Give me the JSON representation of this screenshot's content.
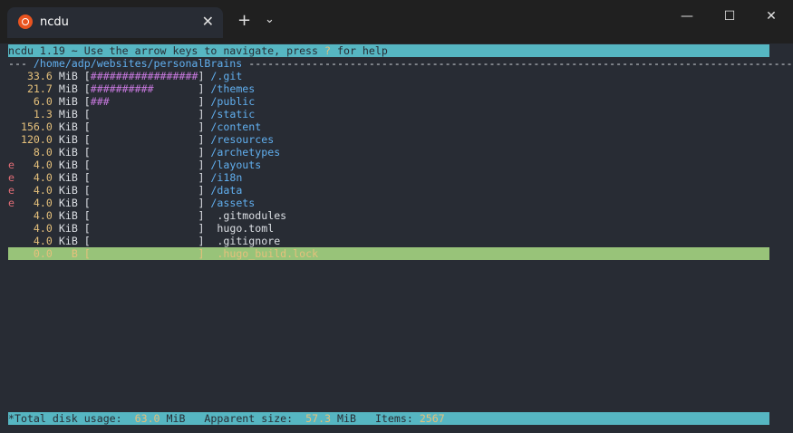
{
  "tab": {
    "title": "ncdu",
    "close": "✕"
  },
  "titlebar": {
    "newtab": "+",
    "dropdown": "⌄",
    "minimize": "—",
    "maximize": "☐",
    "close": "✕"
  },
  "header": {
    "prefix": "ncdu 1.19 ~ Use the arrow keys to navigate, press ",
    "key": "?",
    "suffix": " for help"
  },
  "pathline": {
    "lead": "--- ",
    "path": "/home/adp/websites/personalBrains",
    "trail": " ----------------------------------------------------------------------------------------"
  },
  "rows": [
    {
      "flag": " ",
      "size": "  33.6",
      "unit": "MiB",
      "bar": "#################",
      "name": "/.git",
      "isDir": true
    },
    {
      "flag": " ",
      "size": "  21.7",
      "unit": "MiB",
      "bar": "##########       ",
      "name": "/themes",
      "isDir": true
    },
    {
      "flag": " ",
      "size": "   6.0",
      "unit": "MiB",
      "bar": "###              ",
      "name": "/public",
      "isDir": true
    },
    {
      "flag": " ",
      "size": "   1.3",
      "unit": "MiB",
      "bar": "                 ",
      "name": "/static",
      "isDir": true
    },
    {
      "flag": " ",
      "size": " 156.0",
      "unit": "KiB",
      "bar": "                 ",
      "name": "/content",
      "isDir": true
    },
    {
      "flag": " ",
      "size": " 120.0",
      "unit": "KiB",
      "bar": "                 ",
      "name": "/resources",
      "isDir": true
    },
    {
      "flag": " ",
      "size": "   8.0",
      "unit": "KiB",
      "bar": "                 ",
      "name": "/archetypes",
      "isDir": true
    },
    {
      "flag": "e",
      "size": "   4.0",
      "unit": "KiB",
      "bar": "                 ",
      "name": "/layouts",
      "isDir": true
    },
    {
      "flag": "e",
      "size": "   4.0",
      "unit": "KiB",
      "bar": "                 ",
      "name": "/i18n",
      "isDir": true
    },
    {
      "flag": "e",
      "size": "   4.0",
      "unit": "KiB",
      "bar": "                 ",
      "name": "/data",
      "isDir": true
    },
    {
      "flag": "e",
      "size": "   4.0",
      "unit": "KiB",
      "bar": "                 ",
      "name": "/assets",
      "isDir": true
    },
    {
      "flag": " ",
      "size": "   4.0",
      "unit": "KiB",
      "bar": "                 ",
      "name": " .gitmodules",
      "isDir": false
    },
    {
      "flag": " ",
      "size": "   4.0",
      "unit": "KiB",
      "bar": "                 ",
      "name": " hugo.toml",
      "isDir": false
    },
    {
      "flag": " ",
      "size": "   4.0",
      "unit": "KiB",
      "bar": "                 ",
      "name": " .gitignore",
      "isDir": false
    },
    {
      "flag": " ",
      "size": "   0.0",
      "unit": "  B",
      "bar": "                 ",
      "name": " .hugo_build.lock",
      "isDir": false,
      "selected": true
    }
  ],
  "footer": {
    "total_label": "*Total disk usage:",
    "total_value": "63.0",
    "total_unit": "MiB",
    "apparent_label": "Apparent size:",
    "apparent_value": "57.3",
    "apparent_unit": "MiB",
    "items_label": "Items:",
    "items_value": "2567"
  }
}
